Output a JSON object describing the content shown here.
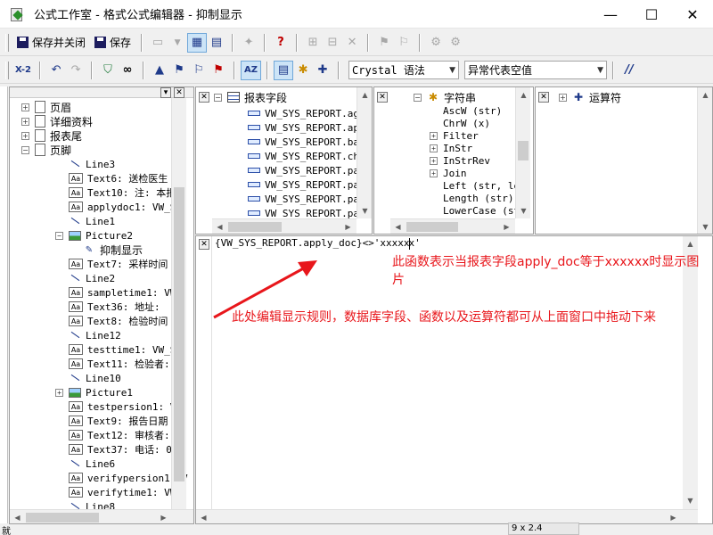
{
  "window": {
    "title": "公式工作室 - 格式公式编辑器 - 抑制显示",
    "minimize": "—",
    "maximize": "☐",
    "close": "✕"
  },
  "toolbar1": {
    "save_close": "保存并关闭",
    "save": "保存",
    "help": "?"
  },
  "toolbar2": {
    "check_label": "X-2",
    "syntax_combo": "Crystal 语法",
    "null_combo": "异常代表空值",
    "comment_btn": "//"
  },
  "left_tree": {
    "items": [
      {
        "label": "页眉",
        "icon": "page-icon",
        "expander": "+"
      },
      {
        "label": "详细资料",
        "icon": "page-icon",
        "expander": "+"
      },
      {
        "label": "报表尾",
        "icon": "page-icon",
        "expander": "+"
      },
      {
        "label": "页脚",
        "icon": "page-icon",
        "expander": "−"
      },
      {
        "label": "Line3",
        "icon": "line-icon"
      },
      {
        "label": "Text6: 送检医生",
        "icon": "text-icon"
      },
      {
        "label": "Text10: 注: 本报",
        "icon": "text-icon"
      },
      {
        "label": "applydoc1: VW_S",
        "icon": "text-icon"
      },
      {
        "label": "Line1",
        "icon": "line-icon"
      },
      {
        "label": "Picture2",
        "icon": "picture-icon",
        "expander": "−"
      },
      {
        "label": "抑制显示",
        "icon": "formula-icon"
      },
      {
        "label": "Text7: 采样时间",
        "icon": "text-icon"
      },
      {
        "label": "Line2",
        "icon": "line-icon"
      },
      {
        "label": "sampletime1: VW",
        "icon": "text-icon"
      },
      {
        "label": "Text36: 地址:",
        "icon": "text-icon"
      },
      {
        "label": "Text8: 检验时间",
        "icon": "text-icon"
      },
      {
        "label": "Line12",
        "icon": "line-icon"
      },
      {
        "label": "testtime1: VW_S",
        "icon": "text-icon"
      },
      {
        "label": "Text11: 检验者:",
        "icon": "text-icon"
      },
      {
        "label": "Line10",
        "icon": "line-icon"
      },
      {
        "label": "Picture1",
        "icon": "picture-icon",
        "expander": "+"
      },
      {
        "label": "testpersion1: VW",
        "icon": "text-icon"
      },
      {
        "label": "Text9: 报告日期",
        "icon": "text-icon"
      },
      {
        "label": "Text12: 审核者:",
        "icon": "text-icon"
      },
      {
        "label": "Text37: 电话: 0",
        "icon": "text-icon"
      },
      {
        "label": "Line6",
        "icon": "line-icon"
      },
      {
        "label": "verifypersion1: V",
        "icon": "text-icon"
      },
      {
        "label": "verifytime1: VW",
        "icon": "text-icon"
      },
      {
        "label": "Line8",
        "icon": "line-icon"
      }
    ]
  },
  "fields_panel": {
    "root": "报表字段",
    "items": [
      "VW_SYS_REPORT.ag",
      "VW_SYS_REPORT.ap",
      "VW_SYS_REPORT.ba",
      "VW_SYS_REPORT.ch",
      "VW_SYS_REPORT.pa",
      "VW_SYS_REPORT.pa",
      "VW_SYS_REPORT.pa",
      "VW_SYS_REPORT.pa"
    ]
  },
  "functions_panel": {
    "root": "字符串",
    "items": [
      {
        "label": "AscW (str)",
        "expander": ""
      },
      {
        "label": "ChrW (x)",
        "expander": ""
      },
      {
        "label": "Filter",
        "expander": "+"
      },
      {
        "label": "InStr",
        "expander": "+"
      },
      {
        "label": "InStrRev",
        "expander": "+"
      },
      {
        "label": "Join",
        "expander": "+"
      },
      {
        "label": "Left (str, le",
        "expander": ""
      },
      {
        "label": "Length (str)",
        "expander": ""
      },
      {
        "label": "LowerCase (st",
        "expander": ""
      }
    ]
  },
  "operators_panel": {
    "root": "运算符"
  },
  "editor": {
    "formula_before_caret": "{VW_SYS_REPORT.apply_doc}<>'xxxxx",
    "formula_after_caret": "x'"
  },
  "annotations": {
    "top_note": "此函数表示当报表字段apply_doc等于xxxxxx时显示图片",
    "left_note": "此处编辑显示规则，数据库字段、函数以及运算符都可从上面窗口中拖动下来",
    "color": "#e8161b"
  },
  "status": {
    "left": "就",
    "right": "9 x 2.4"
  }
}
